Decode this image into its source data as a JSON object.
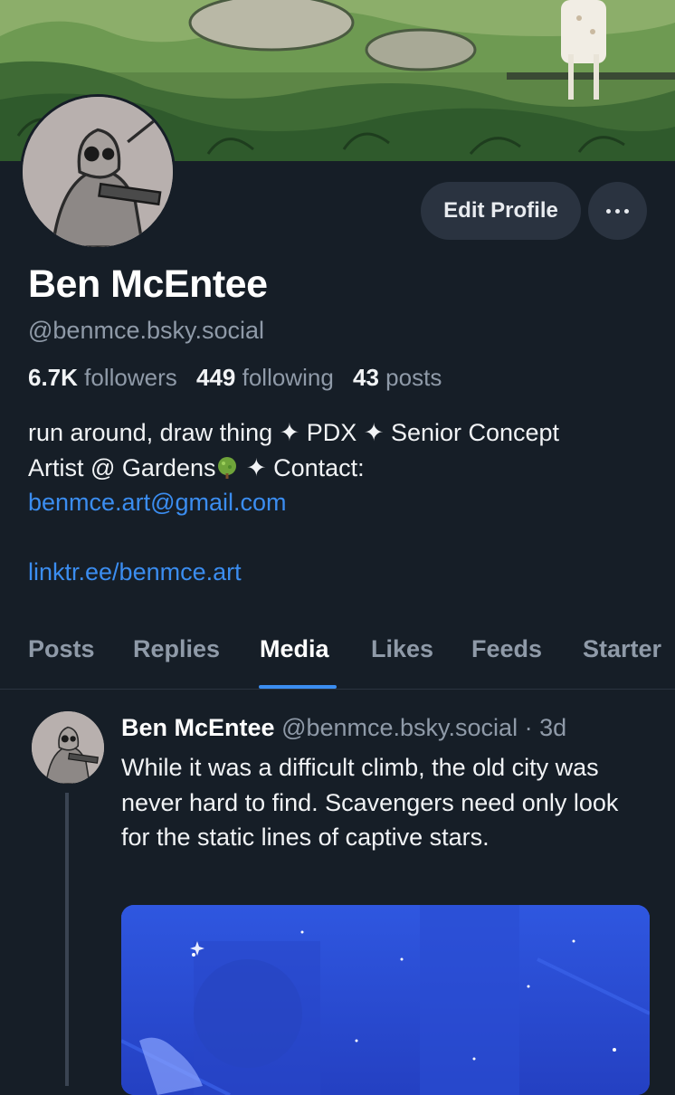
{
  "profile": {
    "display_name": "Ben McEntee",
    "handle": "@benmce.bsky.social",
    "stats": {
      "followers_count": "6.7K",
      "followers_label": "followers",
      "following_count": "449",
      "following_label": "following",
      "posts_count": "43",
      "posts_label": "posts"
    },
    "bio": {
      "line1": "run around, draw thing ✦ PDX ✦ Senior Concept",
      "line2_a": "Artist @ Gardens",
      "line2_b": " ✦ Contact:",
      "email": "benmce.art@gmail.com",
      "link": "linktr.ee/benmce.art"
    },
    "edit_button_label": "Edit Profile",
    "more_button_icon": "more-dots-icon"
  },
  "tabs": [
    {
      "label": "Posts"
    },
    {
      "label": "Replies"
    },
    {
      "label": "Media",
      "active": true
    },
    {
      "label": "Likes"
    },
    {
      "label": "Feeds"
    },
    {
      "label": "Starter"
    }
  ],
  "post": {
    "author_name": "Ben McEntee",
    "author_handle": "@benmce.bsky.social",
    "separator": "·",
    "time": "3d",
    "text": "While it was a difficult climb, the old city was never hard to find. Scavengers need only look for the static lines of captive stars."
  },
  "colors": {
    "background": "#161e27",
    "accent": "#3b8df0",
    "muted_text": "#8f9aa8",
    "button_bg": "#2a3340"
  }
}
